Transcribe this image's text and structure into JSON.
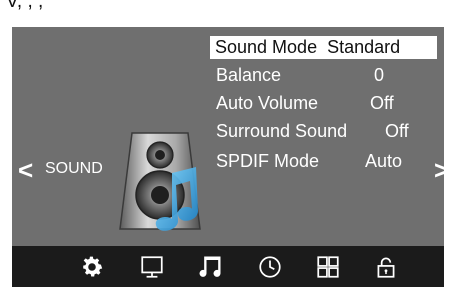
{
  "top_fragment": "V, , ,",
  "panel": {
    "section_label": "SOUND",
    "left_arrow": "<",
    "right_arrow": ">"
  },
  "menu": {
    "items": [
      {
        "label": "Sound Mode",
        "value": "Standard",
        "selected": true
      },
      {
        "label": "Balance",
        "value": "0",
        "selected": false
      },
      {
        "label": "Auto Volume",
        "value": "Off",
        "selected": false
      },
      {
        "label": "Surround Sound",
        "value": "Off",
        "selected": false
      },
      {
        "label": "SPDIF Mode",
        "value": "Auto",
        "selected": false
      }
    ]
  },
  "bottom_bar": {
    "icons": [
      "gear-icon",
      "monitor-icon",
      "music-note-icon",
      "clock-icon",
      "grid-icon",
      "lock-icon"
    ],
    "active_icon": "music-note-icon"
  },
  "colors": {
    "panel": "#6f6f6f",
    "bar": "#1b1b1b",
    "highlight": "#ffffff",
    "text": "#ffffff"
  }
}
